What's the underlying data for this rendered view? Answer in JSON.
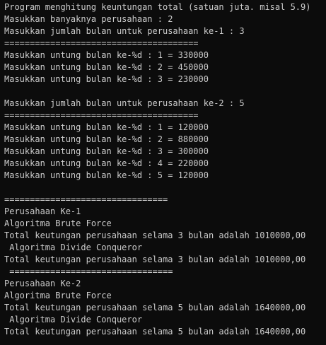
{
  "console": {
    "lines": [
      "Program menghitung keuntungan total (satuan juta. misal 5.9)",
      "Masukkan banyaknya perusahaan : 2",
      "Masukkan jumlah bulan untuk perusahaan ke-1 : 3",
      "======================================",
      "Masukkan untung bulan ke-%d : 1 = 330000",
      "Masukkan untung bulan ke-%d : 2 = 450000",
      "Masukkan untung bulan ke-%d : 3 = 230000",
      "",
      "Masukkan jumlah bulan untuk perusahaan ke-2 : 5",
      "======================================",
      "Masukkan untung bulan ke-%d : 1 = 120000",
      "Masukkan untung bulan ke-%d : 2 = 880000",
      "Masukkan untung bulan ke-%d : 3 = 300000",
      "Masukkan untung bulan ke-%d : 4 = 220000",
      "Masukkan untung bulan ke-%d : 5 = 120000",
      "",
      "================================",
      "Perusahaan Ke-1",
      "Algoritma Brute Force",
      "Total keutungan perusahaan selama 3 bulan adalah 1010000,00",
      " Algoritma Divide Conqueror",
      "Total keutungan perusahaan selama 3 bulan adalah 1010000,00",
      " ================================",
      "Perusahaan Ke-2",
      "Algoritma Brute Force",
      "Total keutungan perusahaan selama 5 bulan adalah 1640000,00",
      " Algoritma Divide Conqueror",
      "Total keutungan perusahaan selama 5 bulan adalah 1640000,00"
    ]
  }
}
